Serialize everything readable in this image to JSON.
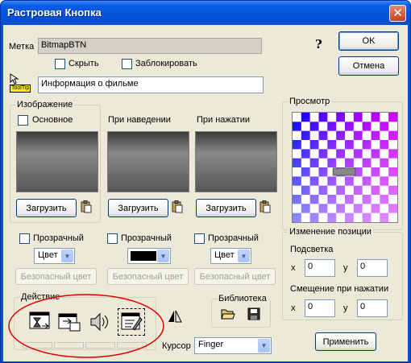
{
  "window": {
    "title": "Растровая Кнопка",
    "close_glyph": "✕"
  },
  "top": {
    "label_caption": "Метка",
    "label_value": "BitmapBTN",
    "hide_label": "Скрыть",
    "lock_label": "Заблокировать",
    "help_glyph": "?",
    "tooltip_badge": "ToolTip",
    "tooltip_value": "Информация о фильме"
  },
  "buttons": {
    "ok": "OK",
    "cancel": "Отмена",
    "apply": "Применить",
    "load": "Загрузить",
    "safe_color": "Безопасный цвет"
  },
  "image_group": {
    "title": "Изображение",
    "main_label": "Основное",
    "hover_label": "При наведении",
    "press_label": "При нажатии"
  },
  "transparency": {
    "label": "Прозрачный",
    "select_value": "Цвет"
  },
  "preview": {
    "title": "Просмотр"
  },
  "position": {
    "title": "Изменение позиции",
    "highlight_label": "Подсветка",
    "x_label": "x",
    "y_label": "y",
    "highlight_x": "0",
    "highlight_y": "0",
    "shift_label": "Смещение при нажатии",
    "shift_x": "0",
    "shift_y": "0"
  },
  "action_group": {
    "title": "Действие"
  },
  "library_group": {
    "title": "Библиотека"
  },
  "cursor": {
    "label": "Курсор",
    "value": "Finger"
  },
  "colors": {
    "annotation_ellipse": "#E00000",
    "titlebar": "#0452DB"
  }
}
